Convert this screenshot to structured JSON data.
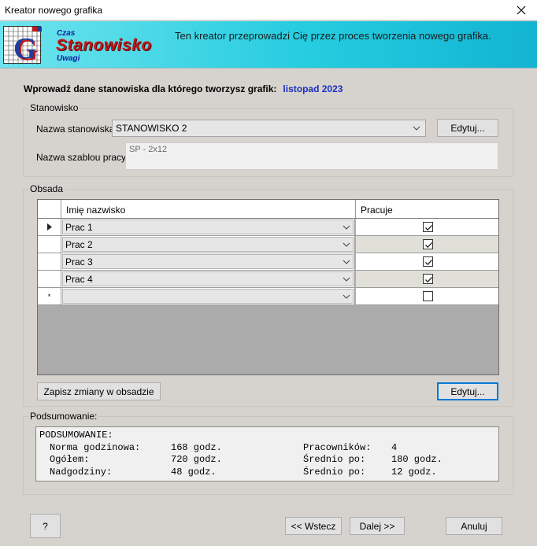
{
  "window": {
    "title": "Kreator nowego grafika"
  },
  "header": {
    "logo_czas": "Czas",
    "logo_stanowisko": "Stanowisko",
    "logo_uwagi": "Uwagi",
    "logo_letter": "G",
    "description": "Ten kreator przeprowadzi Cię przez proces tworzenia nowego grafika."
  },
  "intro": {
    "label": "Wprowadź dane stanowiska dla którego tworzysz grafik:",
    "month": "listopad 2023"
  },
  "stanowisko": {
    "group_label": "Stanowisko",
    "name_label": "Nazwa stanowiska:",
    "name_value": "STANOWISKO 2",
    "edit_label": "Edytuj...",
    "template_label": "Nazwa szablou pracy:",
    "template_value": "SP - 2x12"
  },
  "obsada": {
    "group_label": "Obsada",
    "columns": [
      "Imię nazwisko",
      "Pracuje"
    ],
    "rows": [
      {
        "name": "Prac 1",
        "works": true
      },
      {
        "name": "Prac 2",
        "works": true
      },
      {
        "name": "Prac 3",
        "works": true
      },
      {
        "name": "Prac 4",
        "works": true
      }
    ],
    "new_row_marker": "*",
    "save_label": "Zapisz zmiany w obsadzie",
    "edit_label": "Edytuj..."
  },
  "summary": {
    "group_label": "Podsumowanie:",
    "heading": "PODSUMOWANIE:",
    "items": [
      {
        "label": "Norma godzinowa:",
        "value": "168 godz.",
        "label2": "Pracowników:",
        "value2": "4"
      },
      {
        "label": "Ogółem:",
        "value": "720 godz.",
        "label2": "Średnio po:",
        "value2": "180 godz."
      },
      {
        "label": "Nadgodziny:",
        "value": "48 godz.",
        "label2": "Średnio po:",
        "value2": "12 godz."
      }
    ]
  },
  "footer": {
    "help_label": "?",
    "back_label": "<< Wstecz",
    "next_label": "Dalej >>",
    "cancel_label": "Anuluj"
  }
}
